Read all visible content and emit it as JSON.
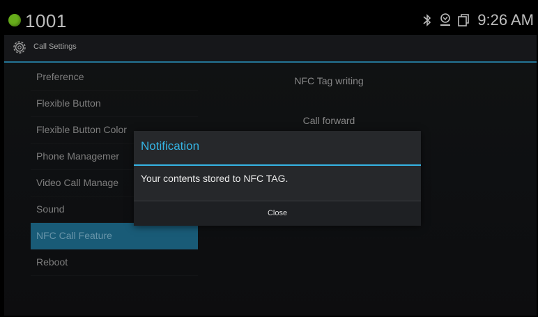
{
  "statusbar": {
    "extension": "1001",
    "time": "9:26 AM",
    "icons": [
      "bluetooth-icon",
      "network-icon",
      "copy-icon"
    ],
    "dot_color": "#7ed321"
  },
  "actionbar": {
    "title": "Call Settings",
    "icon": "gear-icon",
    "accent_color": "#2d8fb8"
  },
  "menu": {
    "items": [
      {
        "label": "Preference"
      },
      {
        "label": "Flexible Button"
      },
      {
        "label": "Flexible Button Color"
      },
      {
        "label": "Phone Managemer"
      },
      {
        "label": "Video Call Manage"
      },
      {
        "label": "Sound"
      },
      {
        "label": "NFC Call Feature",
        "selected": true
      },
      {
        "label": "Reboot"
      }
    ],
    "selected_color": "#1f6f92"
  },
  "right_panel": {
    "items": [
      {
        "label": "NFC Tag writing"
      },
      {
        "label": "Call forward"
      }
    ]
  },
  "dialog": {
    "title": "Notification",
    "message": "Your contents stored to NFC TAG.",
    "button": "Close",
    "accent_color": "#35b5e5"
  }
}
